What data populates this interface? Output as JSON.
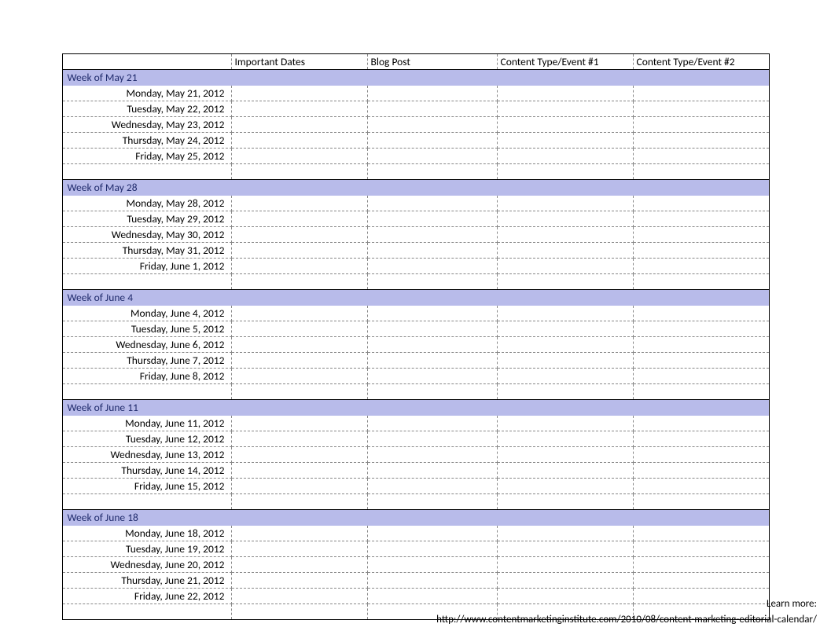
{
  "columns": [
    "",
    "Important Dates",
    "Blog Post",
    "Content Type/Event #1",
    "Content Type/Event #2"
  ],
  "weeks": [
    {
      "label": "Week of May 21",
      "days": [
        "Monday, May 21, 2012",
        "Tuesday, May 22, 2012",
        "Wednesday, May 23, 2012",
        "Thursday, May 24, 2012",
        "Friday, May 25, 2012"
      ]
    },
    {
      "label": "Week of May 28",
      "days": [
        "Monday, May 28, 2012",
        "Tuesday, May 29, 2012",
        "Wednesday, May 30, 2012",
        "Thursday, May 31, 2012",
        "Friday, June 1, 2012"
      ]
    },
    {
      "label": "Week of June 4",
      "days": [
        "Monday, June 4, 2012",
        "Tuesday, June 5, 2012",
        "Wednesday, June 6, 2012",
        "Thursday, June 7, 2012",
        "Friday, June 8, 2012"
      ]
    },
    {
      "label": "Week of June 11",
      "days": [
        "Monday, June 11, 2012",
        "Tuesday, June 12, 2012",
        "Wednesday, June 13, 2012",
        "Thursday, June 14, 2012",
        "Friday, June 15, 2012"
      ]
    },
    {
      "label": "Week of June 18",
      "days": [
        "Monday, June 18, 2012",
        "Tuesday, June 19, 2012",
        "Wednesday, June 20, 2012",
        "Thursday, June 21, 2012",
        "Friday, June 22, 2012"
      ]
    }
  ],
  "footer": {
    "learn_more": "Learn more:",
    "url": "http://www.contentmarketinginstitute.com/2010/08/content-marketing-editorial-calendar/"
  }
}
